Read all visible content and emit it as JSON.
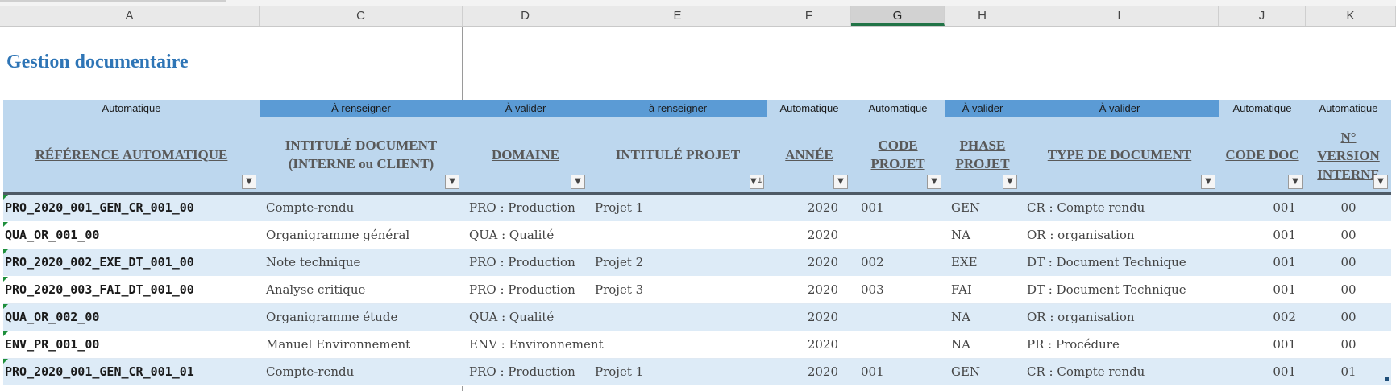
{
  "columns": [
    "A",
    "C",
    "D",
    "E",
    "F",
    "G",
    "H",
    "I",
    "J",
    "K"
  ],
  "selected_column": "G",
  "title": "Gestion documentaire",
  "status": [
    "Automatique",
    "À renseigner",
    "À valider",
    "à renseigner",
    "Automatique",
    "Automatique",
    "À valider",
    "À valider",
    "Automatique",
    "Automatique"
  ],
  "headers": {
    "ref": "RÉFÉRENCE AUTOMATIQUE",
    "intitule_doc_1": "INTITULÉ DOCUMENT",
    "intitule_doc_2": "(INTERNE ou CLIENT)",
    "domaine": "DOMAINE",
    "intitule_projet": "INTITULÉ PROJET",
    "annee": "ANNÉE",
    "code_projet_1": "CODE",
    "code_projet_2": "PROJET",
    "phase_1": "PHASE",
    "phase_2": "PROJET",
    "type_doc": "TYPE DE DOCUMENT",
    "code_doc": "CODE DOC",
    "version_1": "N°",
    "version_2": "VERSION",
    "version_3": "INTERNE"
  },
  "rows": [
    {
      "ref": "PRO_2020_001_GEN_CR_001_00",
      "intitule": "Compte-rendu",
      "domaine": "PRO : Production",
      "projet": "Projet 1",
      "annee": "2020",
      "code_projet": "001",
      "phase": "GEN",
      "type": "CR : Compte rendu",
      "code_doc": "001",
      "version": "00"
    },
    {
      "ref": "QUA_OR_001_00",
      "intitule": "Organigramme général",
      "domaine": "QUA : Qualité",
      "projet": "",
      "annee": "2020",
      "code_projet": "",
      "phase": "NA",
      "type": "OR : organisation",
      "code_doc": "001",
      "version": "00"
    },
    {
      "ref": "PRO_2020_002_EXE_DT_001_00",
      "intitule": "Note technique",
      "domaine": "PRO : Production",
      "projet": "Projet 2",
      "annee": "2020",
      "code_projet": "002",
      "phase": "EXE",
      "type": "DT : Document Technique",
      "code_doc": "001",
      "version": "00"
    },
    {
      "ref": "PRO_2020_003_FAI_DT_001_00",
      "intitule": "Analyse critique",
      "domaine": "PRO : Production",
      "projet": "Projet 3",
      "annee": "2020",
      "code_projet": "003",
      "phase": "FAI",
      "type": "DT : Document Technique",
      "code_doc": "001",
      "version": "00"
    },
    {
      "ref": "QUA_OR_002_00",
      "intitule": "Organigramme étude",
      "domaine": "QUA : Qualité",
      "projet": "",
      "annee": "2020",
      "code_projet": "",
      "phase": "NA",
      "type": "OR : organisation",
      "code_doc": "002",
      "version": "00"
    },
    {
      "ref": "ENV_PR_001_00",
      "intitule": "Manuel Environnement",
      "domaine": "ENV : Environnement",
      "projet": "",
      "annee": "2020",
      "code_projet": "",
      "phase": "NA",
      "type": "PR : Procédure",
      "code_doc": "001",
      "version": "00"
    },
    {
      "ref": "PRO_2020_001_GEN_CR_001_01",
      "intitule": "Compte-rendu",
      "domaine": "PRO : Production",
      "projet": "Projet 1",
      "annee": "2020",
      "code_projet": "001",
      "phase": "GEN",
      "type": "CR : Compte rendu",
      "code_doc": "001",
      "version": "01"
    }
  ],
  "colors": {
    "title": "#2e75b6",
    "header_bg": "#bdd7ee",
    "status_dark": "#5b9bd5",
    "band": "#ddebf7",
    "triangle": "#1e8f3c"
  }
}
